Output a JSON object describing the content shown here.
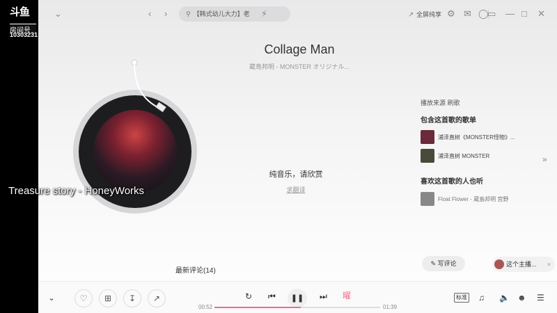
{
  "overlay": {
    "platform_logo": "斗鱼",
    "room_label": "房间号",
    "room_id": "10303231",
    "caption": "Treasure story - HoneyWorks"
  },
  "topbar": {
    "search_text": "【韩式幼儿大力】老",
    "fullscreen_label": "全屏纯享"
  },
  "song": {
    "title": "Collage Man",
    "subtitle": "蔵島邦明 -   MONSTER オリジナル..."
  },
  "lyrics": {
    "pure_music": "纯音乐，请欣赏",
    "correct_link": "求翻译"
  },
  "right_panel": {
    "play_source_label": "播放来源",
    "play_source_value": "刷歌",
    "playlists_title": "包含这首歌的歌单",
    "playlists": [
      {
        "text": "浦泽直树《MONSTER怪物》..."
      },
      {
        "text": "浦泽直树 MONSTER"
      }
    ],
    "listeners_title": "喜欢这首歌的人也听",
    "listeners": [
      {
        "text": "Float Flower - 蔵島邦明 宫野"
      }
    ]
  },
  "comments": {
    "label": "最新评论(14)",
    "write_label": "写评论",
    "host_label": "这个主播..."
  },
  "player": {
    "time_current": "00:52",
    "time_total": "01:39",
    "progress": 0.52,
    "quality_label": "标准"
  },
  "colors": {
    "accent": "#f06a8c",
    "background": "#f4f4f5"
  }
}
